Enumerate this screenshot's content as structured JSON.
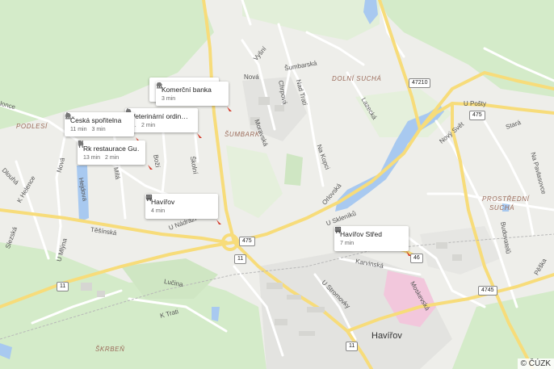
{
  "map": {
    "copyright": "© ČÚZK",
    "street_labels": [
      {
        "id": "vysni",
        "text": "Vyšní"
      },
      {
        "id": "sumbarska",
        "text": "Šumbarská"
      },
      {
        "id": "nova",
        "text": "Nová"
      },
      {
        "id": "chrpova",
        "text": "Chrpová"
      },
      {
        "id": "nad-trati",
        "text": "Nad Tratí"
      },
      {
        "id": "moravska",
        "text": "Moravská"
      },
      {
        "id": "lazecka",
        "text": "Lazecká"
      },
      {
        "id": "na-kopci",
        "text": "Na Kopci"
      },
      {
        "id": "orlovska",
        "text": "Orlovská"
      },
      {
        "id": "u-posty",
        "text": "U Pošty"
      },
      {
        "id": "novy-svet",
        "text": "Nový Svět"
      },
      {
        "id": "stara",
        "text": "Stará"
      },
      {
        "id": "na-pavlasovce",
        "text": "Na Pavlasovce"
      },
      {
        "id": "u-skleniku",
        "text": "U Skleníků"
      },
      {
        "id": "karvinska",
        "text": "Karvinská"
      },
      {
        "id": "u-stromovky",
        "text": "U Stromovky"
      },
      {
        "id": "moskevska",
        "text": "Moskevská"
      },
      {
        "id": "budovatelu",
        "text": "Budovatelů"
      },
      {
        "id": "peska",
        "text": "Pěška"
      },
      {
        "id": "dlouha",
        "text": "Dlouhá"
      },
      {
        "id": "k-helence",
        "text": "K Helence"
      },
      {
        "id": "nova-w",
        "text": "Nová"
      },
      {
        "id": "hejdova",
        "text": "Hejdova"
      },
      {
        "id": "mila",
        "text": "Mílá"
      },
      {
        "id": "tesinska",
        "text": "Těšínská"
      },
      {
        "id": "u-mlyna",
        "text": "U Mlýna"
      },
      {
        "id": "u-nadrazi",
        "text": "U Nádraží"
      },
      {
        "id": "slezska",
        "text": "Slezská"
      },
      {
        "id": "lucina",
        "text": "Lučina"
      },
      {
        "id": "k-trati",
        "text": "K Trati"
      },
      {
        "id": "skolni",
        "text": "Školní"
      },
      {
        "id": "bozi",
        "text": "Boží"
      },
      {
        "id": "lonce",
        "text": "lonce"
      }
    ],
    "area_labels": [
      {
        "id": "dolni-sucha",
        "text": "DOLNÍ SUCHÁ"
      },
      {
        "id": "podlesi",
        "text": "PODLESÍ"
      },
      {
        "id": "sumbark",
        "text": "ŠUMBARK"
      },
      {
        "id": "prostredni-sucha-1",
        "text": "PROSTŘEDNÍ"
      },
      {
        "id": "prostredni-sucha-2",
        "text": "SUCHÁ"
      },
      {
        "id": "skrben",
        "text": "ŠKRBEŇ"
      }
    ],
    "city_label": "Havířov",
    "road_shields": [
      "47210",
      "475",
      "475",
      "11",
      "11",
      "11",
      "4745",
      "46"
    ]
  },
  "cards": [
    {
      "name": "Komerční banka",
      "icon": "bank-icon",
      "meta": [
        {
          "icon": "car-icon",
          "text": "3 min"
        }
      ]
    },
    {
      "name": "Česká spořitelna",
      "icon": "bank-icon",
      "meta": [
        {
          "icon": "walk-icon",
          "text": "11 min"
        },
        {
          "icon": "car-icon",
          "text": "3 min"
        }
      ]
    },
    {
      "name": "Veterinární ordin…",
      "icon": "",
      "meta": [
        {
          "icon": "walk-icon",
          "text": "…"
        },
        {
          "icon": "car-icon",
          "text": "2 min"
        }
      ]
    },
    {
      "name": "Rk restaurace Gu…",
      "icon": "restaurant-icon",
      "meta": [
        {
          "icon": "walk-icon",
          "text": "13 min"
        },
        {
          "icon": "car-icon",
          "text": "2 min"
        }
      ]
    },
    {
      "name": "Havířov",
      "icon": "bus-icon",
      "meta": [
        {
          "icon": "car-icon",
          "text": "4 min"
        }
      ]
    },
    {
      "name": "Havířov Střed",
      "icon": "bus-icon",
      "meta": [
        {
          "icon": "car-icon",
          "text": "7 min"
        }
      ]
    }
  ]
}
